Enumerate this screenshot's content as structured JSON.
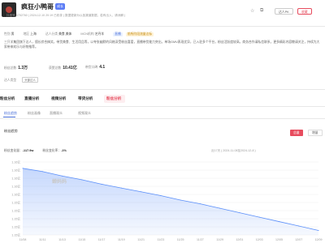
{
  "header": {
    "name": "疯狂小鸭哥",
    "level_badge": "成长",
    "meta": "抖音号 3752760  |  2024-12-10 20:19 已收录  ( 数据更新为以各渠道数据，若有出入，请谅解 )",
    "icons": [
      "star-icon",
      "copy-icon"
    ],
    "pk_button": "达人PK",
    "follow_button": "收藏"
  },
  "info": {
    "gender_label": "性别",
    "gender": "男",
    "region_label": "地区",
    "region": "上海",
    "category_label": "达人分类",
    "category": "美食,美体",
    "mcn_label": "MCN机构",
    "mcn": "艺丹羊",
    "tag1": "直播",
    "tag2": "前所阶段流量达标"
  },
  "description": "三只羊集团旗下达人，擅长综合搞笑，带货美食、生活用品等，以夸张幽默的风格深受粉丝喜爱，直播带货能力突出，单场GMV表现优异，已入驻多个平台，粉丝活跃度较高，商务合作请私信联系，更多精彩内容敬请关注，持续为大家带来欢乐与好物推荐。",
  "stats": {
    "fans_label": "粉丝总数",
    "fans_value": "1.3万",
    "fans_unit": "万",
    "likes_label": "获赞总数",
    "likes_value": "10.41亿",
    "score_label": "带货口碑",
    "score_value": "4.1",
    "type_label": "达人类型",
    "type_tag": "头部达人"
  },
  "tabs": [
    "粉丝分析",
    "直播分析",
    "视频分析",
    "带货分析",
    "粉丝分析"
  ],
  "active_tab": 4,
  "subtabs": [
    "粉丝趋势",
    "粉丝画像",
    "直播观众",
    "视频观众"
  ],
  "active_subtab": 0,
  "section": {
    "title": "粉丝趋势",
    "seg_active": "总量",
    "seg_inactive": "增量"
  },
  "legend": {
    "fans_change_label": "粉丝变化量",
    "fans_change_value": "-117.9w",
    "fans_rate_label": "粉丝变化率",
    "fans_rate_value": "-1%",
    "range": "近17天  ( 2024-11-08至2024-12-8 )"
  },
  "watermark": "蝉妈妈",
  "chart_data": {
    "type": "area",
    "x": [
      "11/08",
      "11/11",
      "11/13",
      "11/15",
      "11/17",
      "11/19",
      "11/21",
      "11/23",
      "11/25",
      "11/27",
      "11/29",
      "12/01",
      "12/03",
      "12/05",
      "12/07",
      "12/09"
    ],
    "y_ticks": [
      "1.16亿",
      "1.16亿",
      "1.16亿",
      "1.16亿",
      "1.16亿",
      "1.15亿",
      "1.15亿",
      "1.15亿",
      "1.15亿",
      "1.15亿"
    ],
    "values": [
      1.164,
      1.1635,
      1.1628,
      1.1622,
      1.1615,
      1.1609,
      1.1603,
      1.1597,
      1.159,
      1.1584,
      1.1577,
      1.157,
      1.1563,
      1.1556,
      1.1549,
      1.1542
    ],
    "ylim": [
      1.1535,
      1.165
    ],
    "color": "#5b8ff9"
  }
}
